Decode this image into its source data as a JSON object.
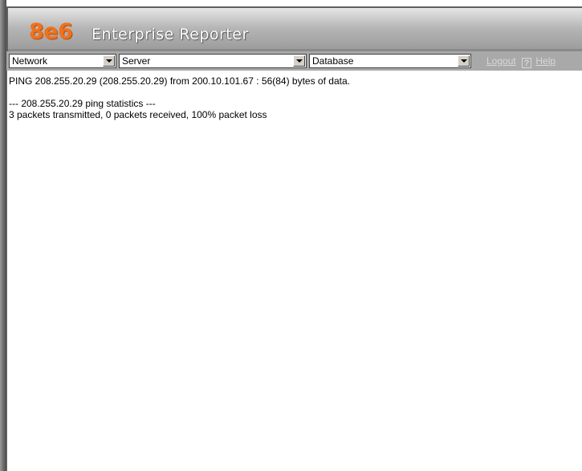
{
  "header": {
    "brand": "8e6",
    "title": "Enterprise Reporter"
  },
  "toolbar": {
    "network_select": {
      "value": "Network"
    },
    "server_select": {
      "value": "Server"
    },
    "database_select": {
      "value": "Database"
    },
    "logout_label": "Logout",
    "help_icon_glyph": "?",
    "help_label": "Help"
  },
  "output": {
    "lines": [
      "PING 208.255.20.29 (208.255.20.29) from 200.10.101.67 : 56(84) bytes of data.",
      "",
      "--- 208.255.20.29 ping statistics ---",
      "3 packets transmitted, 0 packets received, 100% packet loss"
    ]
  },
  "colors": {
    "brand_orange": "#f0711c",
    "header_gray": "#a9a9a9",
    "link_gray": "#d8d8d8"
  }
}
